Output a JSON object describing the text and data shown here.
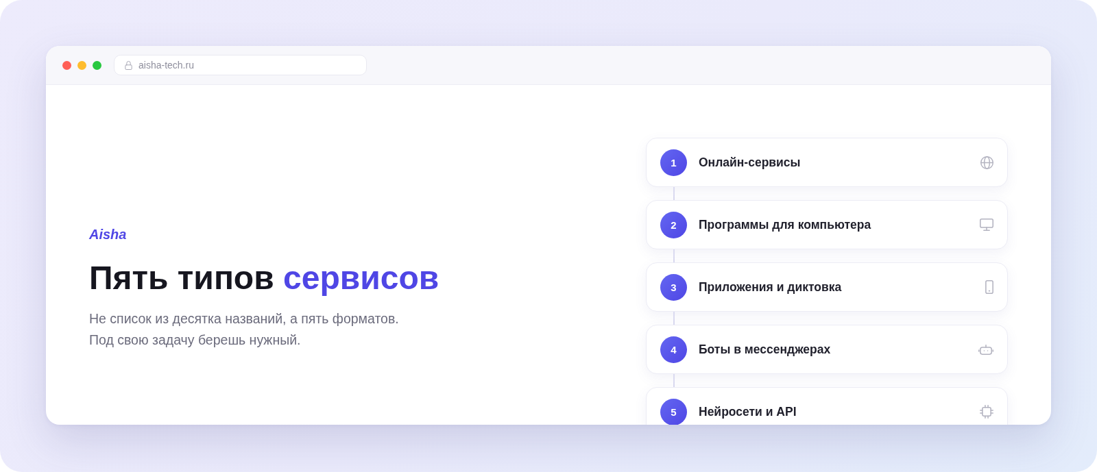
{
  "window": {
    "buttons": [
      {
        "color": "#ff5f57"
      },
      {
        "color": "#febc2e"
      },
      {
        "color": "#28c840"
      }
    ],
    "address": "aisha-tech.ru"
  },
  "hero": {
    "brand": "Aisha",
    "heading": "Пять типов",
    "heading_accent": "сервисов",
    "description": [
      "Не список из десятка названий, а пять форматов.",
      "Под свою задачу берешь нужный."
    ]
  },
  "services": [
    {
      "number": "1",
      "title": "Онлайн-сервисы",
      "kind": "web"
    },
    {
      "number": "2",
      "title": "Программы для компьютера",
      "kind": "desktop"
    },
    {
      "number": "3",
      "title": "Приложения и диктовка",
      "kind": "mobile"
    },
    {
      "number": "4",
      "title": "Боты в мессенджерах",
      "kind": "bot"
    },
    {
      "number": "5",
      "title": "Нейросети и API",
      "kind": "api"
    }
  ]
}
